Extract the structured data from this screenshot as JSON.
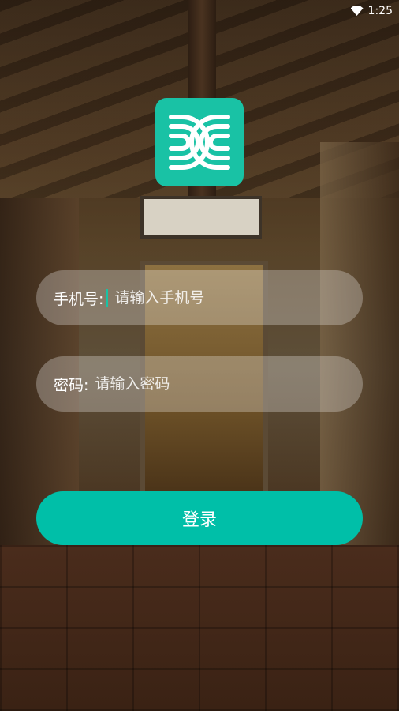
{
  "status_bar": {
    "time": "1:25",
    "wifi_icon": "wifi-icon"
  },
  "logo": {
    "icon": "app-logo-icon",
    "color": "#19c2a5"
  },
  "form": {
    "phone": {
      "label": "手机号:",
      "placeholder": "请输入手机号",
      "value": ""
    },
    "password": {
      "label": "密码:",
      "placeholder": "请输入密码",
      "value": ""
    }
  },
  "login_button": {
    "label": "登录",
    "color": "#00bfa8"
  }
}
